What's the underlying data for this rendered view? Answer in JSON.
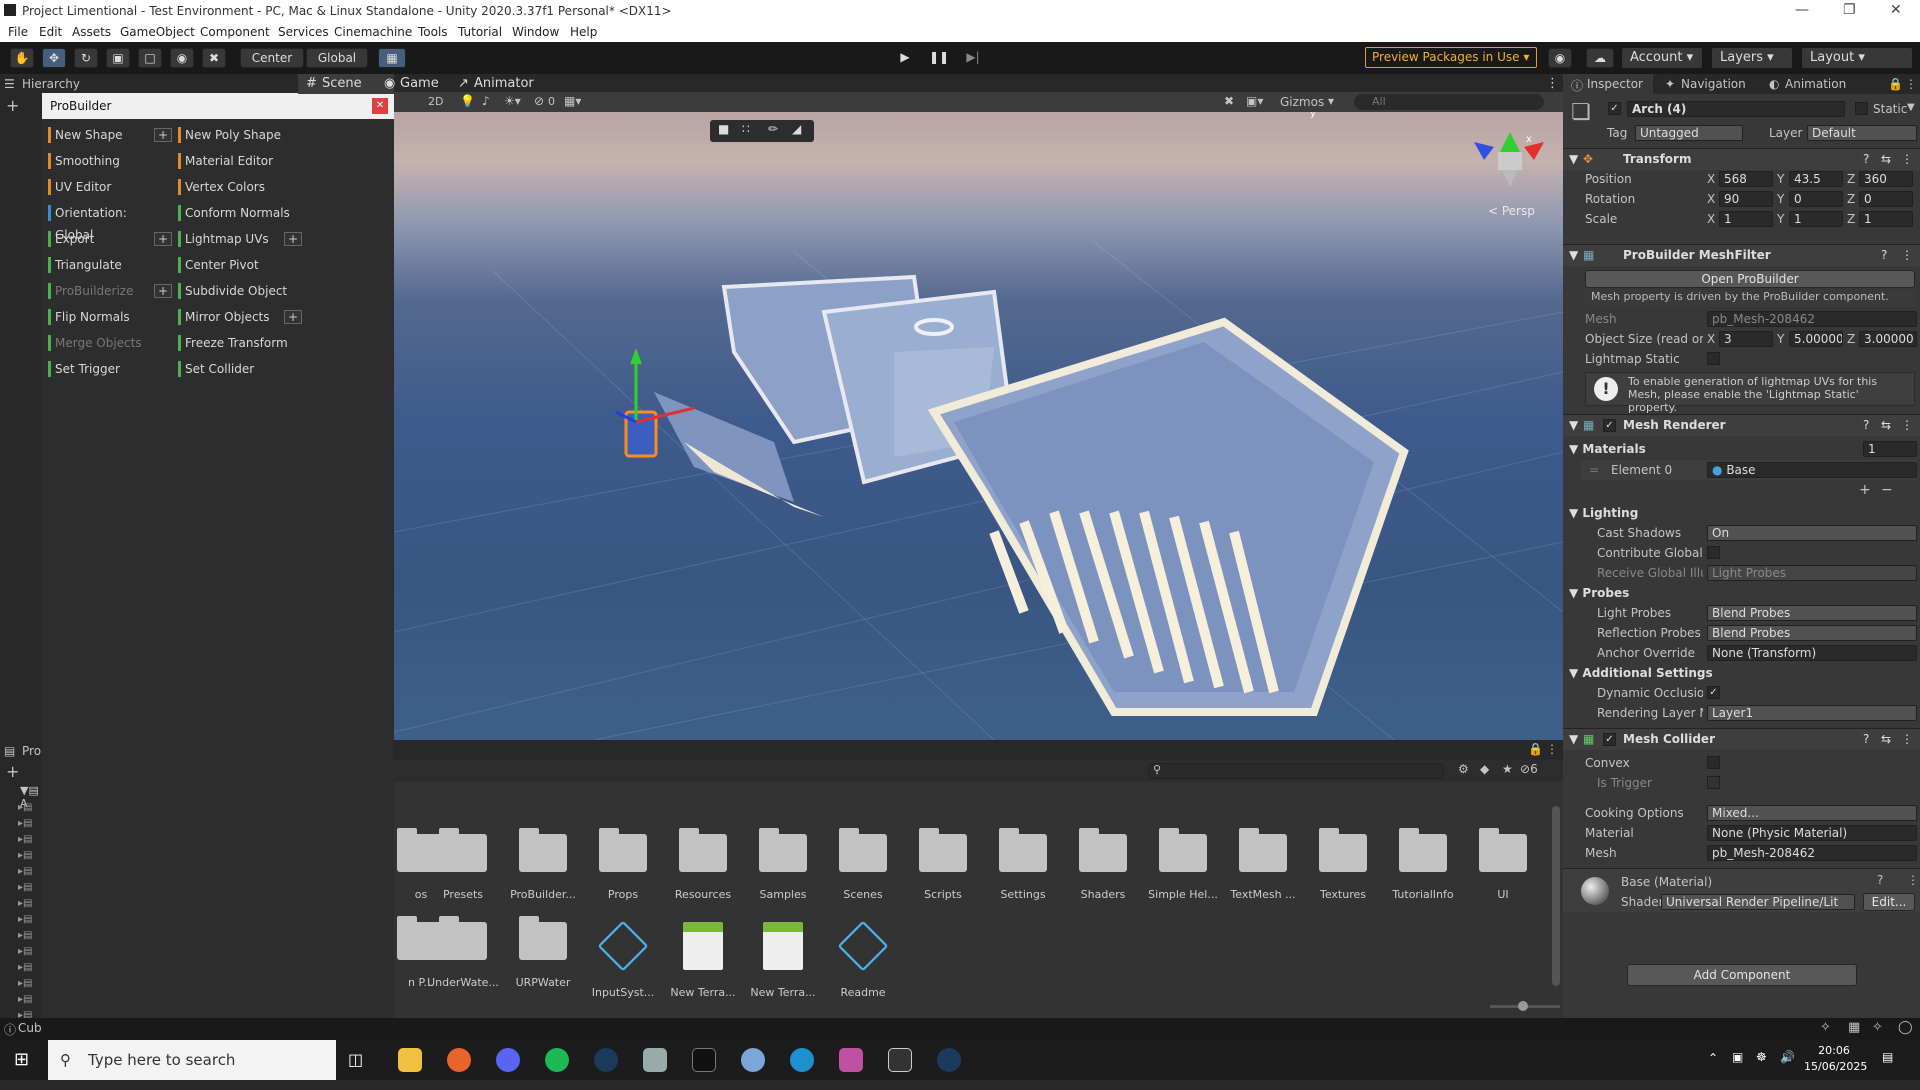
{
  "window": {
    "title": "Project Limentional - Test Environment - PC, Mac & Linux Standalone - Unity 2020.3.37f1 Personal* <DX11>"
  },
  "menu": [
    "File",
    "Edit",
    "Assets",
    "GameObject",
    "Component",
    "Services",
    "Cinemachine",
    "Tools",
    "Tutorial",
    "Window",
    "Help"
  ],
  "toolbar": {
    "center": "Center",
    "global": "Global",
    "preview": "Preview Packages in Use",
    "account": "Account",
    "layers": "Layers",
    "layout": "Layout"
  },
  "hierarchy": {
    "title": "Hierarchy"
  },
  "probuilder": {
    "title": "ProBuilder",
    "left": [
      {
        "label": "New Shape",
        "plus": true,
        "color": "#e08a30",
        "enabled": true
      },
      {
        "label": "Smoothing",
        "color": "#e08a30",
        "enabled": true
      },
      {
        "label": "UV Editor",
        "color": "#e08a30",
        "enabled": true
      },
      {
        "label": "Orientation: Global",
        "color": "#3a8ad4",
        "enabled": true
      },
      {
        "label": "Export",
        "plus": true,
        "color": "#4caf50",
        "enabled": true
      },
      {
        "label": "Triangulate",
        "color": "#4caf50",
        "enabled": true
      },
      {
        "label": "ProBuilderize",
        "plus": true,
        "color": "#4caf50",
        "enabled": false
      },
      {
        "label": "Flip Normals",
        "color": "#4caf50",
        "enabled": true
      },
      {
        "label": "Merge Objects",
        "color": "#4caf50",
        "enabled": false
      },
      {
        "label": "Set Trigger",
        "color": "#4caf50",
        "enabled": true
      }
    ],
    "right": [
      {
        "label": "New Poly Shape",
        "color": "#e08a30",
        "enabled": true
      },
      {
        "label": "Material Editor",
        "color": "#e08a30",
        "enabled": true
      },
      {
        "label": "Vertex Colors",
        "color": "#e08a30",
        "enabled": true
      },
      {
        "label": "Conform Normals",
        "color": "#4caf50",
        "enabled": true
      },
      {
        "label": "Lightmap UVs",
        "plus": true,
        "color": "#4caf50",
        "enabled": true
      },
      {
        "label": "Center Pivot",
        "color": "#4caf50",
        "enabled": true
      },
      {
        "label": "Subdivide Object",
        "color": "#4caf50",
        "enabled": true
      },
      {
        "label": "Mirror Objects",
        "plus": true,
        "color": "#4caf50",
        "enabled": true
      },
      {
        "label": "Freeze Transform",
        "color": "#4caf50",
        "enabled": true
      },
      {
        "label": "Set Collider",
        "color": "#4caf50",
        "enabled": true
      }
    ]
  },
  "scene": {
    "tabs": [
      "Scene",
      "Game",
      "Animator"
    ],
    "mode2d": "2D",
    "hidden_count": "0",
    "gizmos": "Gizmos",
    "search": "All",
    "persp": "< Persp",
    "axis_y": "y",
    "axis_x": "x"
  },
  "project": {
    "title": "Pro",
    "hidden": "6",
    "row1": [
      "os",
      "Presets",
      "ProBuilder...",
      "Props",
      "Resources",
      "Samples",
      "Scenes",
      "Scripts",
      "Settings",
      "Shaders",
      "Simple Hel...",
      "TextMesh ...",
      "Textures",
      "TutorialInfo",
      "UI"
    ],
    "row2": [
      "n P...",
      "UnderWate...",
      "URPWater",
      "InputSyst...",
      "New Terra...",
      "New Terra...",
      "Readme"
    ],
    "left_label": "A",
    "cube_label": "Cub"
  },
  "inspector": {
    "tabs": [
      "Inspector",
      "Navigation",
      "Animation"
    ],
    "object": "Arch (4)",
    "static": "Static",
    "tag_label": "Tag",
    "tag": "Untagged",
    "layer_label": "Layer",
    "layer": "Default",
    "transform": {
      "title": "Transform",
      "position": [
        "568",
        "43.5",
        "360"
      ],
      "rotation": [
        "90",
        "0",
        "0"
      ],
      "scale": [
        "1",
        "1",
        "1"
      ],
      "labels": [
        "Position",
        "Rotation",
        "Scale"
      ]
    },
    "meshfilter": {
      "title": "ProBuilder MeshFilter",
      "open": "Open ProBuilder",
      "note": "Mesh property is driven by the ProBuilder component.",
      "mesh_label": "Mesh",
      "mesh": "pb_Mesh-208462",
      "size_label": "Object Size (read only)",
      "size": [
        "3",
        "5.00000",
        "3.00000"
      ],
      "lightmap_label": "Lightmap Static",
      "warn": "To enable generation of lightmap UVs for this Mesh, please enable the 'Lightmap Static' property."
    },
    "renderer": {
      "title": "Mesh Renderer",
      "materials": "Materials",
      "mat_count": "1",
      "element": "Element 0",
      "element_val": "Base",
      "lighting": "Lighting",
      "cast_label": "Cast Shadows",
      "cast": "On",
      "contrib_label": "Contribute Global Illumination",
      "receive_label": "Receive Global Illumination",
      "receive": "Light Probes",
      "probes": "Probes",
      "lp_label": "Light Probes",
      "lp": "Blend Probes",
      "rp_label": "Reflection Probes",
      "rp": "Blend Probes",
      "anchor_label": "Anchor Override",
      "anchor": "None (Transform)",
      "additional": "Additional Settings",
      "dyn_label": "Dynamic Occlusion",
      "rl_label": "Rendering Layer Mask",
      "rl": "Layer1"
    },
    "collider": {
      "title": "Mesh Collider",
      "convex": "Convex",
      "trigger": "Is Trigger",
      "cooking_label": "Cooking Options",
      "cooking": "Mixed...",
      "material_label": "Material",
      "material": "None (Physic Material)",
      "mesh_label": "Mesh",
      "mesh": "pb_Mesh-208462"
    },
    "material": {
      "name": "Base (Material)",
      "shader_label": "Shader",
      "shader": "Universal Render Pipeline/Lit",
      "edit": "Edit..."
    },
    "add": "Add Component"
  },
  "taskbar": {
    "search": "Type here to search",
    "time": "20:06",
    "date": "15/06/2025"
  }
}
